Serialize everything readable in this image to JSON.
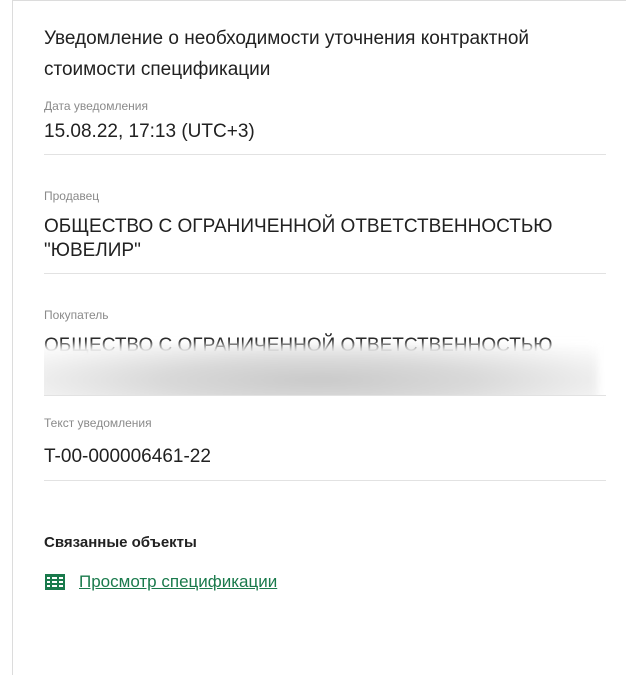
{
  "notice": {
    "title": "Уведомление о необходимости уточнения контрактной стоимости спецификации"
  },
  "fields": {
    "date": {
      "label": "Дата уведомления",
      "value": "15.08.22, 17:13 (UTC+3)"
    },
    "seller": {
      "label": "Продавец",
      "value": "ОБЩЕСТВО С ОГРАНИЧЕННОЙ ОТВЕТСТВЕННОСТЬЮ \"ЮВЕЛИР\""
    },
    "buyer": {
      "label": "Покупатель",
      "value": "ОБЩЕСТВО С ОГРАНИЧЕННОЙ ОТВЕТСТВЕННОСТЬЮ"
    },
    "notice_text": {
      "label": "Текст уведомления",
      "value": "T-00-000006461-22"
    }
  },
  "related": {
    "title": "Связанные объекты",
    "link_label": "Просмотр спецификации",
    "link_icon": "table-icon",
    "link_color": "#1a7a4c"
  }
}
